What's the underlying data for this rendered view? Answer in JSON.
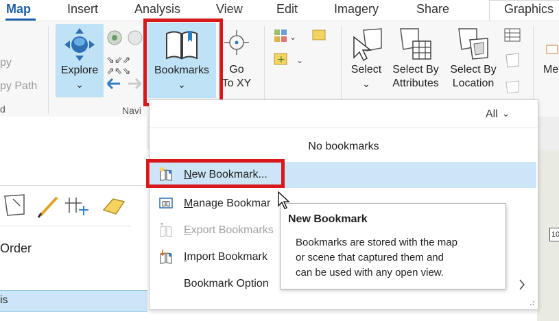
{
  "tabs": [
    "Map",
    "Insert",
    "Analysis",
    "View",
    "Edit",
    "Imagery",
    "Share",
    "Graphics"
  ],
  "ribbon": {
    "clipped_left": [
      "py",
      "py Path",
      "d"
    ],
    "explore_label": "Explore",
    "bookmarks_label": "Bookmarks",
    "goto_label_1": "Go",
    "goto_label_2": "To XY",
    "select_label": "Select",
    "select_by_attr_1": "Select By",
    "select_by_attr_2": "Attributes",
    "select_by_loc_1": "Select By",
    "select_by_loc_2": "Location",
    "clipped_right": "Me",
    "nav_group_label": "Navi",
    "chevron": "⌄"
  },
  "dropdown": {
    "filter_label": "All",
    "empty_text": "No bookmarks",
    "items": [
      {
        "label": "New Bookmark...",
        "underline_char": "N",
        "rest": "ew Bookmark...",
        "enabled": true,
        "icon": "new-bookmark-icon"
      },
      {
        "label": "Manage Bookmar",
        "underline_char": "M",
        "rest": "anage Bookmar",
        "enabled": true,
        "icon": "manage-bookmarks-icon"
      },
      {
        "label": "Export Bookmarks",
        "underline_char": "E",
        "rest": "xport Bookmarks",
        "enabled": false,
        "icon": "export-bookmarks-icon"
      },
      {
        "label": "Import Bookmark",
        "underline_char": "I",
        "rest": "mport Bookmark",
        "enabled": true,
        "icon": "import-bookmarks-icon"
      },
      {
        "label": "Bookmark Option",
        "enabled": true
      }
    ]
  },
  "tooltip": {
    "title": "New Bookmark",
    "lines": [
      "Bookmarks are stored with the map",
      "or scene that captured them and",
      "can be used with any open view."
    ]
  },
  "left_panel": {
    "order_label": "Order",
    "row_label": "is"
  },
  "map_label": "10",
  "colors": {
    "accent": "#1d5fa6",
    "highlight": "#cde6f7",
    "redbox": "#d7191c",
    "button_active": "#bfe2f7"
  }
}
